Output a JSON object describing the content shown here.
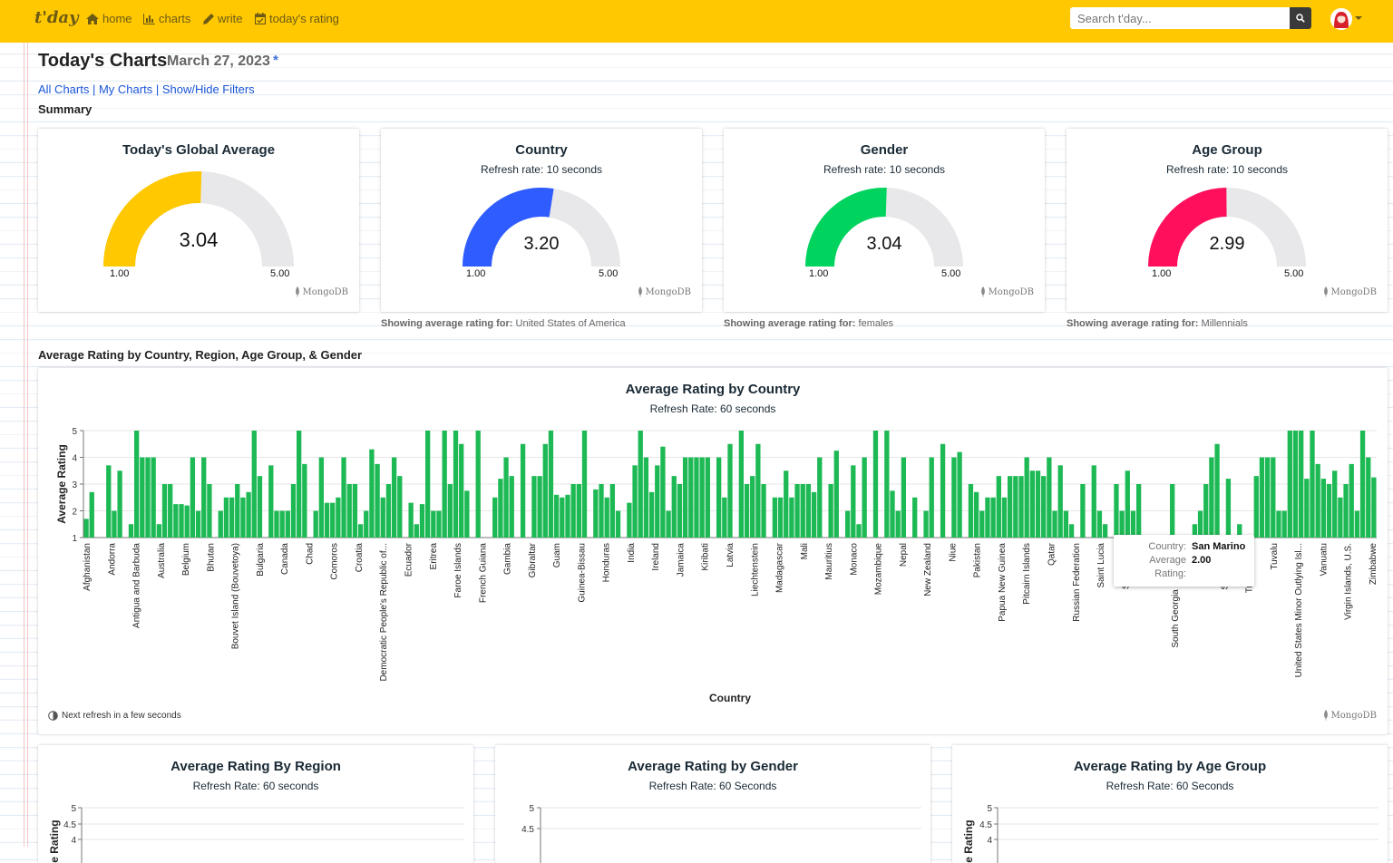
{
  "nav": {
    "brand": "t'day",
    "items": [
      {
        "label": "home",
        "icon": "home-icon"
      },
      {
        "label": "charts",
        "icon": "bar-chart-icon"
      },
      {
        "label": "write",
        "icon": "pencil-icon"
      },
      {
        "label": "today's rating",
        "icon": "calendar-check-icon"
      }
    ],
    "search_placeholder": "Search t'day...",
    "search_icon": "search-icon"
  },
  "header": {
    "title": "Today's Charts",
    "date": "March 27, 2023",
    "star": "*",
    "links": [
      "All Charts",
      "My Charts",
      "Show/Hide Filters"
    ],
    "separator": " | ",
    "summary_label": "Summary",
    "section2_label": "Average Rating by Country, Region, Age Group, & Gender"
  },
  "gauges": [
    {
      "title": "Today's Global Average",
      "subtitle": "",
      "value": "3.04",
      "value_num": 3.04,
      "min": "1.00",
      "max": "5.00",
      "color": "#ffc800",
      "showing_label": "",
      "showing_value": ""
    },
    {
      "title": "Country",
      "subtitle": "Refresh rate: 10 seconds",
      "value": "3.20",
      "value_num": 3.2,
      "min": "1.00",
      "max": "5.00",
      "color": "#2f5cff",
      "showing_label": "Showing average rating for:",
      "showing_value": "United States of America"
    },
    {
      "title": "Gender",
      "subtitle": "Refresh rate: 10 seconds",
      "value": "3.04",
      "value_num": 3.04,
      "min": "1.00",
      "max": "5.00",
      "color": "#00d45f",
      "showing_label": "Showing average rating for:",
      "showing_value": "females"
    },
    {
      "title": "Age Group",
      "subtitle": "Refresh rate: 10 seconds",
      "value": "2.99",
      "value_num": 2.99,
      "min": "1.00",
      "max": "5.00",
      "color": "#ff0f5c",
      "showing_label": "Showing average rating for:",
      "showing_value": "Millennials"
    }
  ],
  "mongo_label": "MongoDB",
  "country_chart": {
    "title": "Average Rating by Country",
    "subtitle": "Refresh Rate: 60 seconds",
    "next_refresh": "Next refresh in a few seconds",
    "tooltip": {
      "country_key": "Country:",
      "country_value": "San Marino",
      "rating_key": "Average Rating:",
      "rating_value": "2.00"
    }
  },
  "chart_data": [
    {
      "type": "bar",
      "title": "Average Rating by Country",
      "subtitle": "Refresh Rate: 60 seconds",
      "xlabel": "Country",
      "ylabel": "Average Rating",
      "ylim": [
        1,
        5
      ],
      "yticks": [
        1,
        2,
        3,
        4,
        5
      ],
      "color": "#1db954",
      "grid": true,
      "labeled_categories": [
        "Afghanistan",
        "Andorra",
        "Antigua and Barbuda",
        "Australia",
        "Belgium",
        "Bhutan",
        "Bouvet Island (Bouvetoya)",
        "Bulgaria",
        "Canada",
        "Chad",
        "Comoros",
        "Croatia",
        "Democratic People's Republic of...",
        "Ecuador",
        "Eritrea",
        "Faroe Islands",
        "French Guiana",
        "Gambia",
        "Gibraltar",
        "Guam",
        "Guinea-Bissau",
        "Honduras",
        "India",
        "Ireland",
        "Jamaica",
        "Kiribati",
        "Latvia",
        "Liechtenstein",
        "Madagascar",
        "Mali",
        "Mauritius",
        "Monaco",
        "Mozambique",
        "Nepal",
        "New Zealand",
        "Niue",
        "Pakistan",
        "Papua New Guinea",
        "Pitcairn Islands",
        "Qatar",
        "Russian Federation",
        "Saint Lucia",
        "San Marino",
        "Se",
        "South Georgia and the So",
        "S",
        "Syrian Arab",
        "Trinidad and",
        "Tuvalu",
        "United States Minor Outlying Isl...",
        "Vanuatu",
        "Virgin Islands, U.S.",
        "Zimbabwe"
      ],
      "values": [
        1.7,
        2.7,
        1.0,
        1.0,
        3.7,
        2.0,
        3.5,
        1.0,
        1.5,
        5.0,
        4.0,
        4.0,
        4.0,
        1.5,
        3.0,
        3.0,
        2.25,
        2.25,
        2.2,
        4.0,
        2.0,
        4.0,
        3.0,
        1.0,
        2.0,
        2.5,
        2.5,
        3.0,
        2.5,
        2.7,
        5.0,
        3.3,
        1.0,
        3.7,
        2.0,
        2.0,
        2.0,
        3.0,
        5.0,
        3.75,
        1.0,
        2.0,
        4.0,
        2.3,
        2.3,
        2.5,
        4.0,
        3.0,
        3.0,
        1.5,
        2.0,
        4.3,
        3.75,
        2.5,
        3.0,
        4.0,
        3.3,
        1.0,
        2.3,
        1.5,
        2.25,
        5.0,
        2.0,
        2.0,
        5.0,
        3.0,
        5.0,
        4.5,
        2.75,
        1.0,
        5.0,
        1.0,
        1.0,
        2.5,
        3.2,
        4.0,
        3.3,
        1.0,
        4.5,
        1.0,
        3.3,
        3.3,
        4.5,
        5.0,
        2.6,
        2.5,
        2.6,
        3.0,
        3.0,
        5.0,
        1.0,
        2.8,
        3.0,
        2.5,
        3.0,
        2.0,
        1.0,
        2.3,
        3.7,
        5.0,
        4.0,
        2.7,
        3.7,
        4.4,
        2.0,
        3.3,
        3.0,
        4.0,
        4.0,
        4.0,
        4.0,
        4.0,
        1.0,
        4.0,
        2.5,
        4.5,
        1.0,
        5.0,
        3.0,
        3.3,
        4.5,
        3.0,
        1.0,
        2.5,
        2.5,
        3.5,
        2.5,
        3.0,
        3.0,
        3.0,
        2.7,
        4.0,
        1.0,
        3.0,
        4.25,
        1.0,
        2.0,
        3.7,
        1.5,
        4.0,
        1.0,
        5.0,
        1.0,
        5.0,
        2.75,
        2.0,
        4.0,
        1.0,
        2.5,
        1.0,
        2.0,
        4.0,
        1.0,
        4.5,
        1.0,
        4.0,
        4.2,
        1.0,
        3.0,
        2.7,
        2.0,
        2.5,
        2.5,
        3.3,
        2.5,
        3.3,
        3.3,
        3.3,
        4.0,
        3.5,
        3.5,
        3.3,
        4.0,
        2.0,
        3.7,
        2.0,
        1.5,
        1.0,
        3.0,
        1.0,
        3.7,
        2.0,
        1.5,
        1.0,
        3.0,
        2.0,
        3.5,
        2.0,
        3.0,
        1.0,
        1.0,
        1.0,
        1.0,
        1.0,
        3.0,
        1.0,
        1.0,
        1.0,
        1.5,
        2.0,
        3.0,
        4.0,
        4.5,
        1.0,
        3.2,
        1.0,
        1.5,
        1.0,
        1.0,
        3.3,
        4.0,
        4.0,
        4.0,
        2.0,
        2.0,
        5.0,
        5.0,
        5.0,
        3.2,
        5.0,
        3.75,
        3.2,
        3.0,
        3.5,
        2.5,
        3.0,
        3.75,
        2.0,
        5.0,
        4.0,
        3.25
      ]
    },
    {
      "type": "bar",
      "title": "Average Rating By Region",
      "subtitle": "Refresh Rate: 60 seconds",
      "ylabel": "Average Rating",
      "yticks": [
        4,
        4.5,
        5
      ]
    },
    {
      "type": "bar",
      "title": "Average Rating by Gender",
      "subtitle": "Refresh Rate: 60 Seconds",
      "yticks": [
        4.5,
        5
      ]
    },
    {
      "type": "bar",
      "title": "Average Rating by Age Group",
      "subtitle": "Refresh Rate: 60 Seconds",
      "ylabel": "Average Rating",
      "yticks": [
        4,
        4.5,
        5
      ]
    }
  ]
}
